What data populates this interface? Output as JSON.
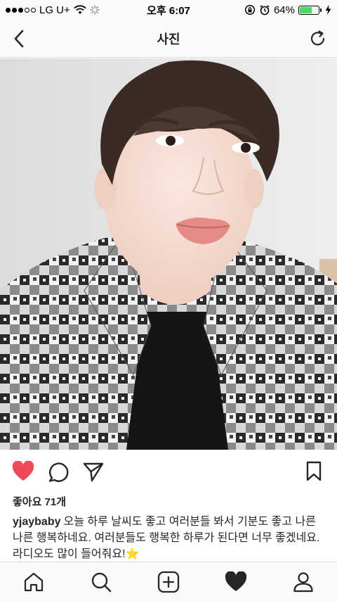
{
  "status": {
    "carrier": "LG U+",
    "time": "오후 6:07",
    "battery": "64%",
    "battery_level": 0.64,
    "battery_color": "#4cd964"
  },
  "nav": {
    "title": "사진",
    "back_icon": "chevron-left-icon",
    "refresh_icon": "refresh-icon"
  },
  "post": {
    "likes": "좋아요 71개",
    "username": "yjaybaby",
    "caption": "오늘 하루 날씨도 좋고 여러분들 봐서 기분도 좋고 나른 나른 행복하네요. 여러분들도 행복한 하루가 된다면 너무 좋겠네요. 라디오도 많이 들어줘요!⭐",
    "liked": true,
    "like_color": "#ed4956"
  },
  "tabs": [
    "home-icon",
    "search-icon",
    "add-icon",
    "activity-icon",
    "profile-icon"
  ]
}
